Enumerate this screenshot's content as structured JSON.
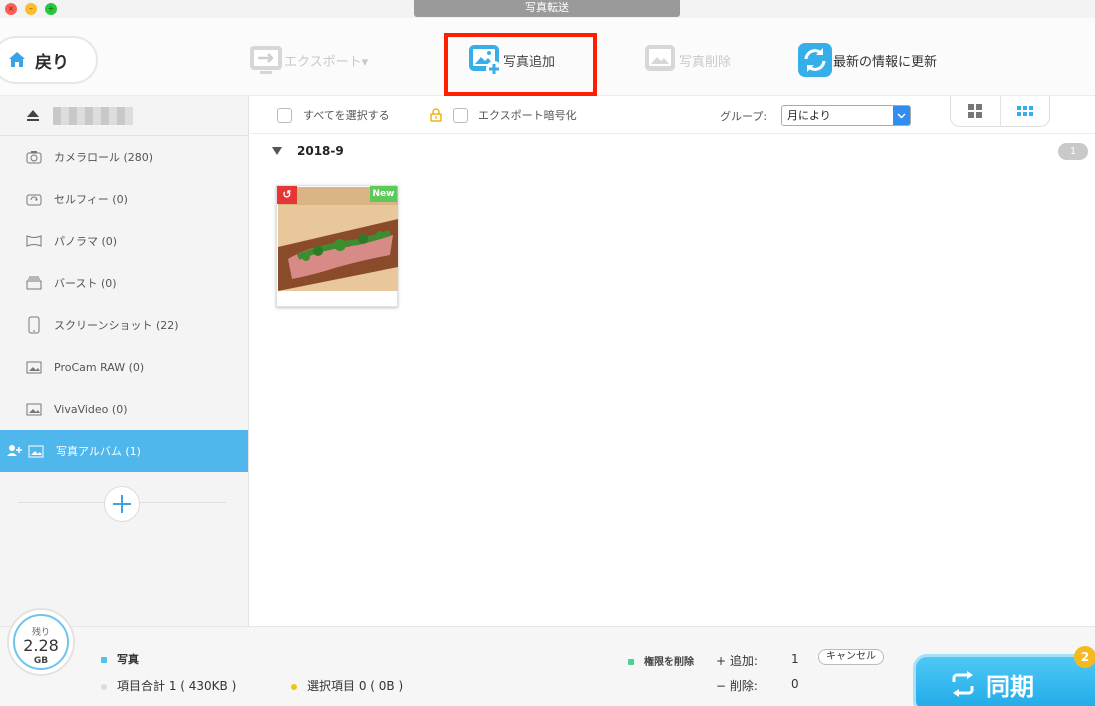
{
  "window": {
    "title": "写真転送"
  },
  "toolbar": {
    "back_label": "戻り",
    "export_label": "エクスポート▾",
    "add_label": "写真追加",
    "delete_label": "写真削除",
    "refresh_label": "最新の情報に更新"
  },
  "sidebar": {
    "items": [
      {
        "label": "カメラロール (280)",
        "icon": "camera-icon"
      },
      {
        "label": "セルフィー (0)",
        "icon": "selfie-camera-icon"
      },
      {
        "label": "パノラマ (0)",
        "icon": "panorama-icon"
      },
      {
        "label": "バースト (0)",
        "icon": "burst-icon"
      },
      {
        "label": "スクリーンショット (22)",
        "icon": "phone-icon"
      },
      {
        "label": "ProCam RAW (0)",
        "icon": "album-icon"
      },
      {
        "label": "VivaVideo (0)",
        "icon": "album-icon"
      },
      {
        "label": "写真アルバム (1)",
        "icon": "album-icon",
        "active": true
      }
    ]
  },
  "filter": {
    "select_all_label": "すべてを選択する",
    "encrypt_label": "エクスポート暗号化",
    "group_label": "グループ:",
    "group_value": "月により"
  },
  "content": {
    "group_title": "2018-9",
    "group_count": "1",
    "photo_badge": "New"
  },
  "footer": {
    "storage_remaining_label": "残り",
    "storage_value": "2.28",
    "storage_unit": "GB",
    "photo_label": "写真",
    "total_label": "項目合計 1 ( 430KB )",
    "selected_label": "選択項目 0 ( 0B )",
    "delete_rights_label": "権限を削除",
    "add_label": "+ 追加:",
    "add_value": "1",
    "remove_label": "− 削除:",
    "remove_value": "0",
    "cancel_label": "キャンセル",
    "sync_label": "同期",
    "sync_badge": "2"
  },
  "colors": {
    "accent": "#4fb7ec",
    "highlight": "#ff1e00",
    "new_badge": "#5ec85a",
    "rotate_badge": "#e63535"
  }
}
